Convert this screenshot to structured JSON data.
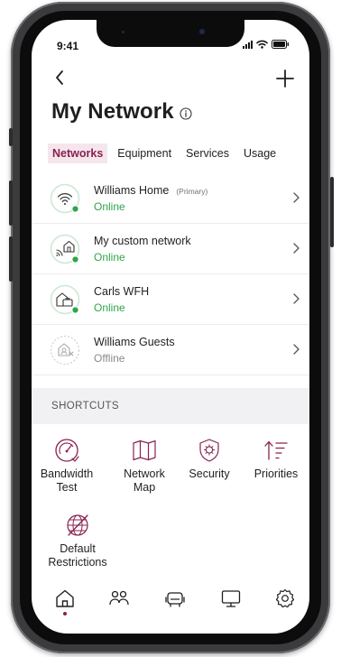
{
  "status_bar": {
    "time": "9:41"
  },
  "header": {
    "title": "My Network"
  },
  "tabs": [
    {
      "label": "Networks",
      "active": true
    },
    {
      "label": "Equipment",
      "active": false
    },
    {
      "label": "Services",
      "active": false
    },
    {
      "label": "Usage",
      "active": false
    }
  ],
  "networks": [
    {
      "name": "Williams Home",
      "badge": "(Primary)",
      "status": "Online",
      "icon": "wifi-icon"
    },
    {
      "name": "My custom network",
      "badge": "",
      "status": "Online",
      "icon": "home-wifi-icon"
    },
    {
      "name": "Carls WFH",
      "badge": "",
      "status": "Online",
      "icon": "home-work-icon"
    },
    {
      "name": "Williams Guests",
      "badge": "",
      "status": "Offline",
      "icon": "guest-network-icon"
    }
  ],
  "shortcuts": {
    "title": "SHORTCUTS",
    "items": [
      {
        "label": "Bandwidth\nTest",
        "icon": "speedometer-icon"
      },
      {
        "label": "Network\nMap",
        "icon": "map-icon"
      },
      {
        "label": "Security",
        "icon": "shield-icon"
      },
      {
        "label": "Priorities",
        "icon": "priorities-icon"
      },
      {
        "label": "Default\nRestrictions",
        "icon": "restricted-globe-icon"
      }
    ]
  },
  "bottom_nav": [
    {
      "icon": "home-icon",
      "active": true
    },
    {
      "icon": "people-icon",
      "active": false
    },
    {
      "icon": "devices-icon",
      "active": false
    },
    {
      "icon": "monitor-icon",
      "active": false
    },
    {
      "icon": "gear-icon",
      "active": false
    }
  ],
  "colors": {
    "accent": "#8a2150",
    "accent_bg": "#f5e6ec",
    "online": "#2fa54a",
    "offline": "#8a8a8a",
    "icon_ring": "#cbe8d3"
  }
}
